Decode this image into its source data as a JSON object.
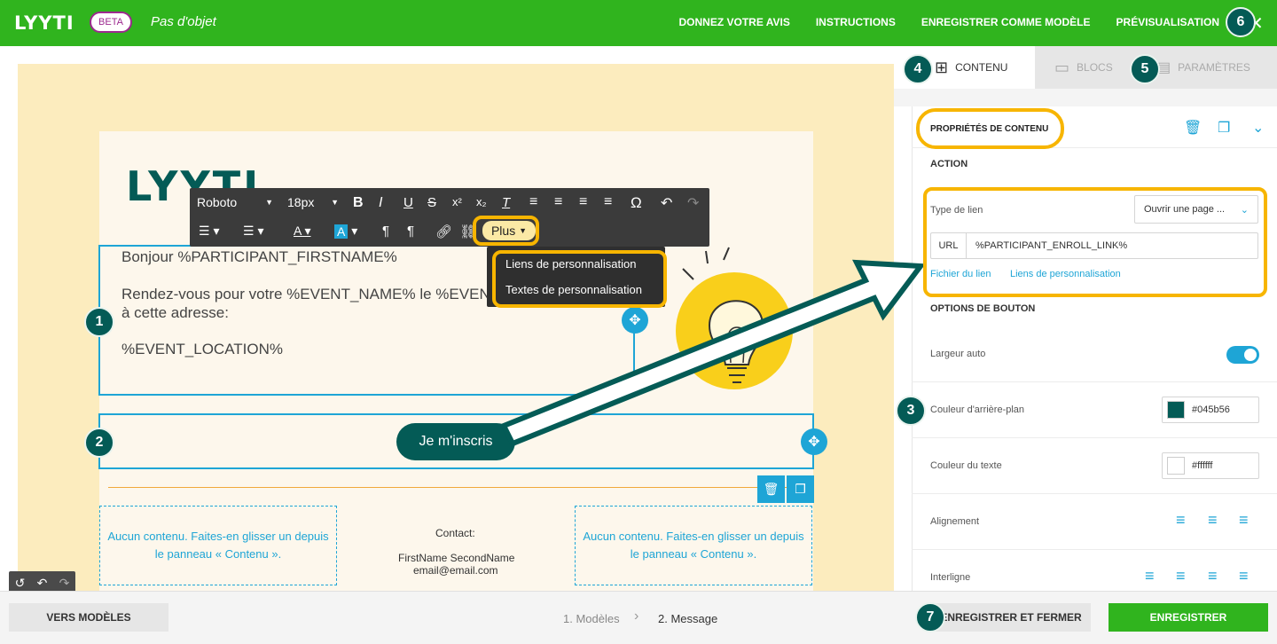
{
  "header": {
    "logo": "LYYTI",
    "beta": "BETA",
    "subject": "Pas d'objet",
    "nav": [
      "DONNEZ VOTRE AVIS",
      "INSTRUCTIONS",
      "ENREGISTRER COMME MODÈLE",
      "PRÉVISUALISATION"
    ]
  },
  "badges": {
    "b1": "1",
    "b2": "2",
    "b3": "3",
    "b4": "4",
    "b5": "5",
    "b6": "6",
    "b7": "7"
  },
  "email": {
    "brand": "LYYTI",
    "greeting": "Bonjour %PARTICIPANT_FIRSTNAME%",
    "line2": "Rendez-vous pour votre %EVENT_NAME% le %EVEN",
    "line3": "à cette adresse:",
    "location": "%EVENT_LOCATION%",
    "cta": "Je m'inscris",
    "empty_left": "Aucun contenu. Faites-en glisser un depuis le panneau « Contenu ».",
    "empty_right": "Aucun contenu. Faites-en glisser un depuis le panneau « Contenu ».",
    "contact_label": "Contact:",
    "contact_name": "FirstName SecondName",
    "contact_email": "email@email.com"
  },
  "toolbar": {
    "font": "Roboto",
    "size": "18px",
    "more": "Plus",
    "menu": [
      "Liens de personnalisation",
      "Textes de personnalisation"
    ]
  },
  "panel": {
    "tabs": [
      "CONTENU",
      "BLOCS",
      "PARAMÈTRES"
    ],
    "props_title": "PROPRIÉTÉS DE CONTENU",
    "action_title": "ACTION",
    "link_type_label": "Type de lien",
    "link_type_value": "Ouvrir une page ...",
    "url_label": "URL",
    "url_value": "%PARTICIPANT_ENROLL_LINK%",
    "file_link": "Fichier du lien",
    "personal_links": "Liens de personnalisation",
    "button_options": "OPTIONS DE BOUTON",
    "auto_width": "Largeur auto",
    "bg_color_label": "Couleur d'arrière-plan",
    "bg_color": "#045b56",
    "text_color_label": "Couleur du texte",
    "text_color": "#ffffff",
    "alignment": "Alignement",
    "line_height": "Interligne"
  },
  "footer": {
    "templates_btn": "VERS MODÈLES",
    "step1": "1. Modèles",
    "step2": "2. Message",
    "save_close": "ENREGISTRER ET FERMER",
    "save": "ENREGISTRER"
  },
  "colors": {
    "accent": "#30b41e",
    "brand": "#045b56",
    "highlight": "#f7b500",
    "selection": "#1ea5d6"
  }
}
